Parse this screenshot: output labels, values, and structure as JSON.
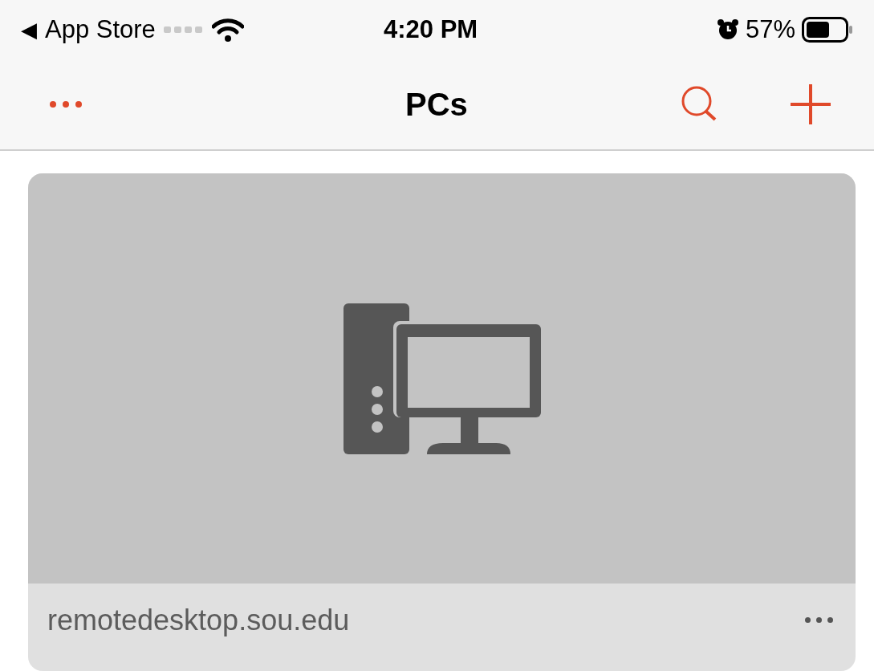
{
  "status_bar": {
    "back_glyph": "◀",
    "back_label": "App Store",
    "time": "4:20 PM",
    "battery": "57%"
  },
  "nav_bar": {
    "title": "PCs"
  },
  "pcs": [
    {
      "name": "remotedesktop.sou.edu"
    }
  ]
}
